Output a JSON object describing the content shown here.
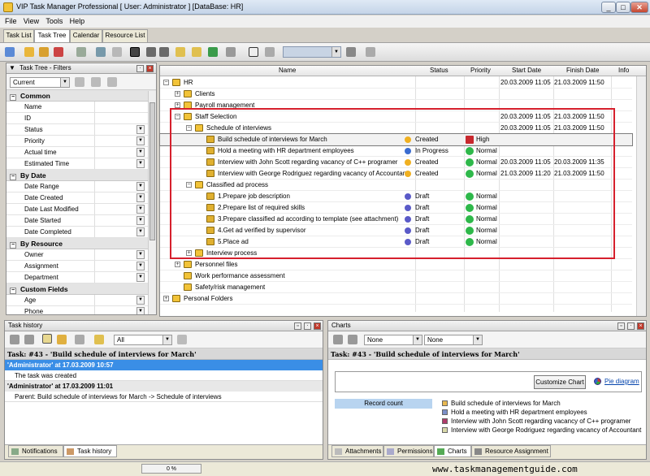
{
  "window": {
    "title": "VIP Task Manager Professional [ User: Administrator ] [DataBase: HR]"
  },
  "menu": [
    "File",
    "View",
    "Tools",
    "Help"
  ],
  "tabs": [
    "Task List",
    "Task Tree",
    "Calendar",
    "Resource List"
  ],
  "filters": {
    "title": "Task Tree - Filters",
    "current": "Current",
    "sections": [
      {
        "title": "Common",
        "fields": [
          "Name",
          "ID",
          "Status",
          "Priority",
          "Actual time",
          "Estimated Time"
        ]
      },
      {
        "title": "By Date",
        "fields": [
          "Date Range",
          "Date Created",
          "Date Last Modified",
          "Date Started",
          "Date Completed"
        ]
      },
      {
        "title": "By Resource",
        "fields": [
          "Owner",
          "Assignment",
          "Department"
        ]
      },
      {
        "title": "Custom Fields",
        "fields": [
          "Age",
          "Phone"
        ]
      }
    ]
  },
  "grid": {
    "columns": [
      "Name",
      "Status",
      "Priority",
      "Start Date",
      "Finish Date",
      "Info"
    ],
    "rows": [
      {
        "name": "HR",
        "level": 0,
        "exp": "−",
        "status": "",
        "priority": "",
        "start": "20.03.2009 11:05",
        "finish": "21.03.2009 11:50"
      },
      {
        "name": "Clients",
        "level": 1,
        "exp": "+",
        "status": "",
        "priority": "",
        "start": "",
        "finish": ""
      },
      {
        "name": "Payroll management",
        "level": 1,
        "exp": "+",
        "status": "",
        "priority": "",
        "start": "",
        "finish": ""
      },
      {
        "name": "Staff Selection",
        "level": 1,
        "exp": "−",
        "status": "",
        "priority": "",
        "start": "20.03.2009 11:05",
        "finish": "21.03.2009 11:50"
      },
      {
        "name": "Schedule of interviews",
        "level": 2,
        "exp": "−",
        "status": "",
        "priority": "",
        "start": "20.03.2009 11:05",
        "finish": "21.03.2009 11:50"
      },
      {
        "name": "Build schedule of interviews for March",
        "level": 3,
        "exp": "",
        "status": "Created",
        "priority": "High",
        "start": "",
        "finish": "",
        "selected": true
      },
      {
        "name": "Hold a meeting with HR department employees",
        "level": 3,
        "exp": "",
        "status": "In Progress",
        "priority": "Normal",
        "start": "",
        "finish": ""
      },
      {
        "name": "Interview with John Scott regarding vacancy of C++ programer",
        "level": 3,
        "exp": "",
        "status": "Created",
        "priority": "Normal",
        "start": "20.03.2009 11:05",
        "finish": "20.03.2009 11:35"
      },
      {
        "name": "Interview with George Rodriguez regarding vacancy of Accountant",
        "level": 3,
        "exp": "",
        "status": "Created",
        "priority": "Normal",
        "start": "21.03.2009 11:20",
        "finish": "21.03.2009 11:50"
      },
      {
        "name": "Classified ad process",
        "level": 2,
        "exp": "−",
        "status": "",
        "priority": "",
        "start": "",
        "finish": ""
      },
      {
        "name": "1.Prepare job description",
        "level": 3,
        "exp": "",
        "status": "Draft",
        "priority": "Normal",
        "start": "",
        "finish": ""
      },
      {
        "name": "2.Prepare list of required skills",
        "level": 3,
        "exp": "",
        "status": "Draft",
        "priority": "Normal",
        "start": "",
        "finish": ""
      },
      {
        "name": "3.Prepare classified ad according to template (see attachment)",
        "level": 3,
        "exp": "",
        "status": "Draft",
        "priority": "Normal",
        "start": "",
        "finish": ""
      },
      {
        "name": "4.Get ad verified by supervisor",
        "level": 3,
        "exp": "",
        "status": "Draft",
        "priority": "Normal",
        "start": "",
        "finish": ""
      },
      {
        "name": "5.Place ad",
        "level": 3,
        "exp": "",
        "status": "Draft",
        "priority": "Normal",
        "start": "",
        "finish": ""
      },
      {
        "name": "Interview process",
        "level": 2,
        "exp": "+",
        "status": "",
        "priority": "",
        "start": "",
        "finish": ""
      },
      {
        "name": "Personnel files",
        "level": 1,
        "exp": "+",
        "status": "",
        "priority": "",
        "start": "",
        "finish": ""
      },
      {
        "name": "Work performance assessment",
        "level": 1,
        "exp": "",
        "status": "",
        "priority": "",
        "start": "",
        "finish": ""
      },
      {
        "name": "Safety/risk management",
        "level": 1,
        "exp": "",
        "status": "",
        "priority": "",
        "start": "",
        "finish": ""
      },
      {
        "name": "Personal Folders",
        "level": 0,
        "exp": "+",
        "status": "",
        "priority": "",
        "start": "",
        "finish": ""
      }
    ]
  },
  "history": {
    "title": "Task history",
    "filter": "All",
    "task": "Task: #43 - 'Build schedule of interviews for March'",
    "entries": [
      {
        "head": "'Administrator' at 17.03.2009 10:57",
        "text": "The task was created"
      },
      {
        "head": "'Administrator' at 17.03.2009 11:01",
        "text": "Parent: Build schedule of interviews for March -> Schedule of interviews"
      }
    ],
    "tabs": [
      "Notifications",
      "Task history"
    ]
  },
  "charts": {
    "title": "Charts",
    "select1": "None",
    "select2": "None",
    "task": "Task: #43 - 'Build schedule of interviews for March'",
    "customize": "Customize Chart",
    "pie": "Pie diagram",
    "record_count": "Record count",
    "legend": [
      {
        "label": "Build schedule of interviews for March",
        "color": "#e8b850"
      },
      {
        "label": "Hold a meeting with HR department employees",
        "color": "#7b8fc8"
      },
      {
        "label": "Interview with John Scott regarding vacancy of C++ programer",
        "color": "#b03c6a"
      },
      {
        "label": "Interview with George Rodriguez regarding vacancy of Accountant",
        "color": "#d8d8a8"
      }
    ],
    "tabs": [
      "Attachments",
      "Permissions",
      "Charts",
      "Resource Assignment"
    ]
  },
  "status": {
    "progress": "0 %",
    "url": "www.taskmanagementguide.com"
  }
}
